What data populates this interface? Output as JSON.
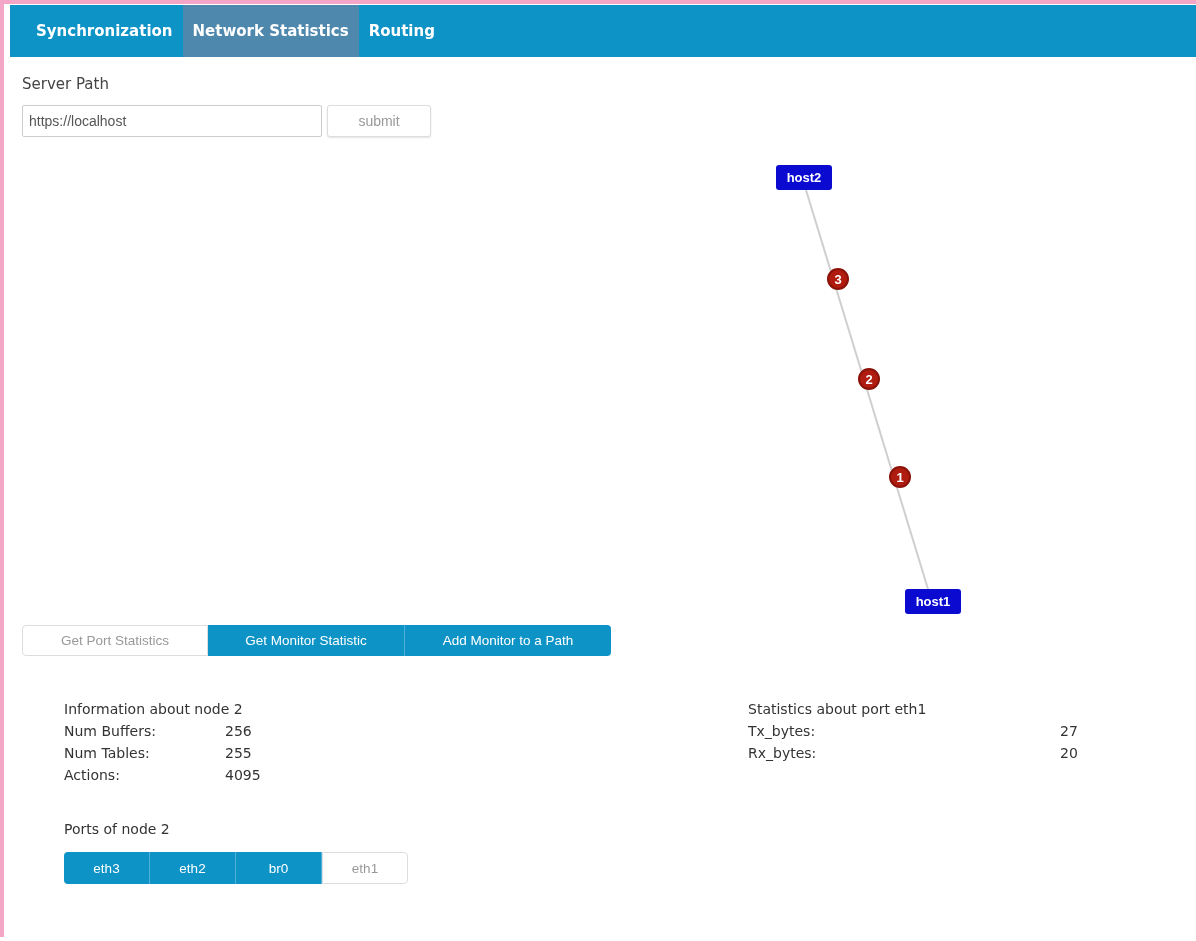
{
  "tabs": [
    {
      "label": "Synchronization",
      "selected": false
    },
    {
      "label": "Network Statistics",
      "selected": true
    },
    {
      "label": "Routing",
      "selected": false
    }
  ],
  "server_path": {
    "label": "Server Path",
    "value": "https://localhost",
    "button": "submit"
  },
  "topology": {
    "nodes": [
      {
        "label": "host2"
      },
      {
        "label": "host1"
      }
    ],
    "hops": [
      {
        "label": "3"
      },
      {
        "label": "2"
      },
      {
        "label": "1"
      }
    ]
  },
  "actions": [
    {
      "label": "Get Port Statistics",
      "selected": true
    },
    {
      "label": "Get Monitor Statistic",
      "selected": false
    },
    {
      "label": "Add Monitor to a Path",
      "selected": false
    }
  ],
  "node_info": {
    "title": "Information about node 2",
    "rows": [
      {
        "label": "Num Buffers:",
        "value": "256"
      },
      {
        "label": "Num Tables:",
        "value": "255"
      },
      {
        "label": "Actions:",
        "value": "4095"
      }
    ]
  },
  "port_stats": {
    "title": "Statistics about port eth1",
    "rows": [
      {
        "label": "Tx_bytes:",
        "value": "27"
      },
      {
        "label": "Rx_bytes:",
        "value": "20"
      }
    ]
  },
  "ports": {
    "title": "Ports of node 2",
    "items": [
      {
        "label": "eth3",
        "selected": false
      },
      {
        "label": "eth2",
        "selected": false
      },
      {
        "label": "br0",
        "selected": false
      },
      {
        "label": "eth1",
        "selected": true
      }
    ]
  }
}
